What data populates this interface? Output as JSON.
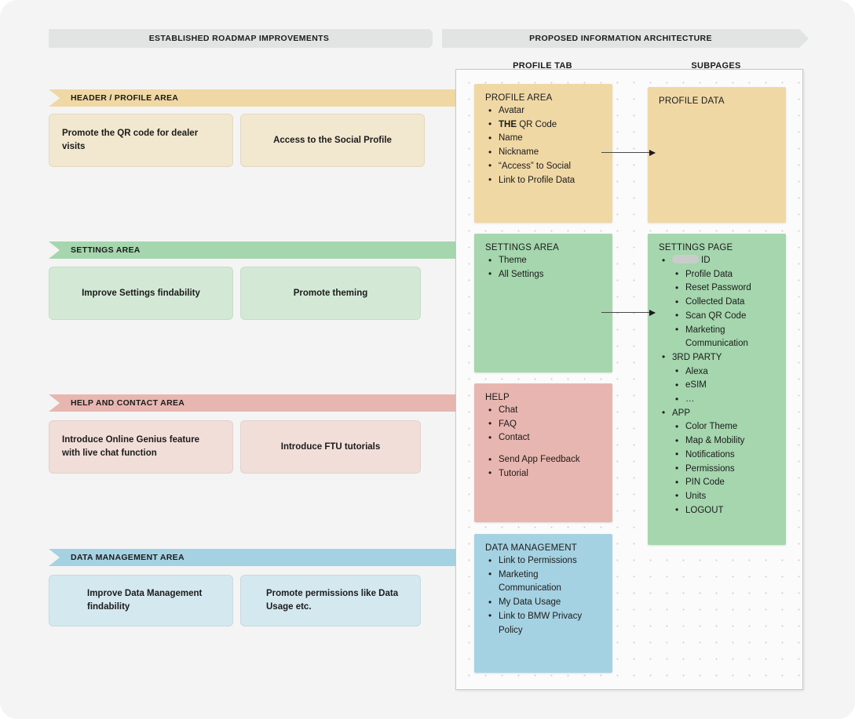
{
  "banners": {
    "left": "ESTABLISHED ROADMAP IMPROVEMENTS",
    "right": "PROPOSED INFORMATION ARCHITECTURE"
  },
  "columns": {
    "profile_tab": "PROFILE TAB",
    "subpages": "SUBPAGES"
  },
  "colors": {
    "header_profile": "#f0d8a5",
    "header_profile_card": "#f2e7cf",
    "settings": "#a5d6ae",
    "settings_card": "#d3e9d6",
    "help": "#e8b6b0",
    "help_card": "#f2ded9",
    "data": "#a5d2e2",
    "data_card": "#d4e8ef",
    "banner_grey": "#e2e3e3",
    "page_bg": "#f4f4f4"
  },
  "sections": [
    {
      "id": "header-profile-area",
      "strip_label": "HEADER / PROFILE AREA",
      "strip_color": "#f0d8a5",
      "card_color": "#f2e7cf",
      "cards": [
        "Promote the QR code for dealer visits",
        "Access to the Social Profile"
      ]
    },
    {
      "id": "settings-area",
      "strip_label": "SETTINGS AREA",
      "strip_color": "#a5d6ae",
      "card_color": "#d3e9d6",
      "cards": [
        "Improve Settings findability",
        "Promote theming"
      ]
    },
    {
      "id": "help-and-contact-area",
      "strip_label": "HELP AND CONTACT AREA",
      "strip_color": "#e8b6b0",
      "card_color": "#f2ded9",
      "cards": [
        "Introduce Online Genius feature with live chat function",
        "Introduce FTU tutorials"
      ]
    },
    {
      "id": "data-management-area",
      "strip_label": "DATA MANAGEMENT AREA",
      "strip_color": "#a5d2e2",
      "card_color": "#d4e8ef",
      "cards": [
        "Improve Data Management findability",
        "Promote permissions like Data Usage etc."
      ]
    }
  ],
  "ia": {
    "profile_area": {
      "title": "PROFILE AREA",
      "items": [
        "Avatar",
        "THE QR Code",
        "Name",
        "Nickname",
        "“Access” to Social",
        "Link to Profile Data"
      ]
    },
    "profile_data": {
      "title": "PROFILE DATA",
      "items": []
    },
    "settings_area": {
      "title": "SETTINGS AREA",
      "items": [
        "Theme",
        "All Settings"
      ]
    },
    "settings_page": {
      "title": "SETTINGS PAGE",
      "id_label": "ID",
      "id_redacted": true,
      "account_items": [
        "Profile Data",
        "Reset Password",
        "Collected Data",
        "Scan QR Code",
        "Marketing Communication"
      ],
      "third_party_label": "3RD PARTY",
      "third_party_items": [
        "Alexa",
        "eSIM",
        "…"
      ],
      "app_label": "APP",
      "app_items": [
        "Color Theme",
        "Map & Mobility",
        "Notifications",
        "Permissions",
        "PIN Code",
        "Units",
        "LOGOUT"
      ]
    },
    "help": {
      "title": "HELP",
      "items_group_1": [
        "Chat",
        "FAQ",
        "Contact"
      ],
      "items_group_2": [
        "Send App Feedback",
        "Tutorial"
      ]
    },
    "data_management": {
      "title": "DATA MANAGEMENT",
      "items": [
        "Link to Permissions",
        "Marketing Communication",
        "My Data Usage",
        "Link to BMW Privacy Policy"
      ]
    }
  }
}
